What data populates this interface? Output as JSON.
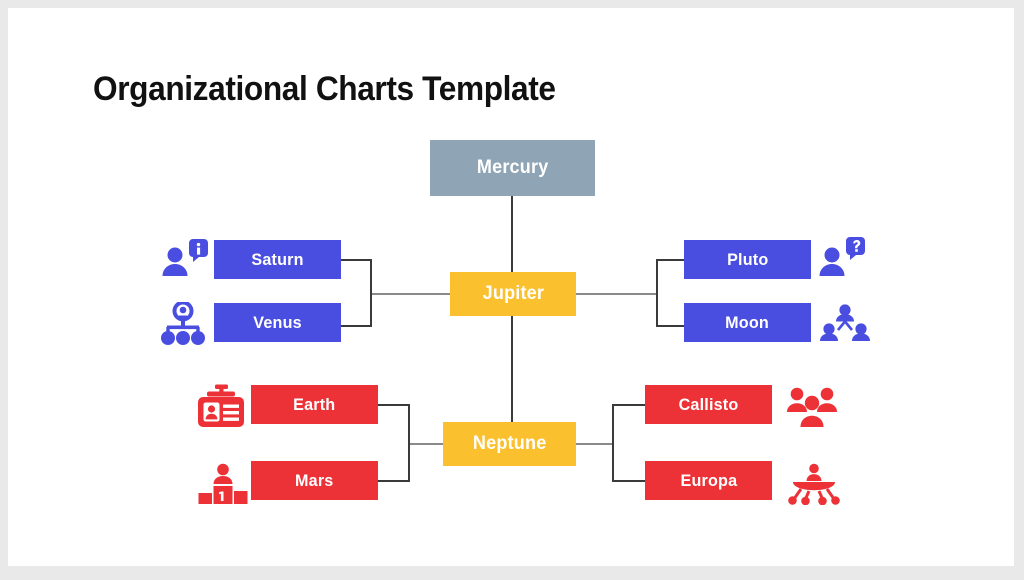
{
  "slide": {
    "title": "Organizational Charts Template",
    "background": "#ffffff",
    "frame_color": "#e9e9e9"
  },
  "colors": {
    "root": "#8fa5b6",
    "center": "#fbc02d",
    "blue": "#4a4ee0",
    "red": "#ec3237",
    "connector": "#3a3a3a",
    "connector_grey": "#8a8a8a",
    "title": "#111111",
    "node_text": "#ffffff"
  },
  "charts": [
    {
      "id": "top-chart",
      "root": {
        "label": "Mercury",
        "color": "#8fa5b6"
      },
      "center": {
        "label": "Jupiter",
        "color": "#fbc02d"
      },
      "left_children": [
        {
          "label": "Saturn",
          "color": "#4a4ee0",
          "icon": "person-info-icon"
        },
        {
          "label": "Venus",
          "color": "#4a4ee0",
          "icon": "hierarchy-icon"
        }
      ],
      "right_children": [
        {
          "label": "Pluto",
          "color": "#4a4ee0",
          "icon": "person-question-icon"
        },
        {
          "label": "Moon",
          "color": "#4a4ee0",
          "icon": "team-network-icon"
        }
      ]
    },
    {
      "id": "bottom-chart",
      "center": {
        "label": "Neptune",
        "color": "#fbc02d"
      },
      "left_children": [
        {
          "label": "Earth",
          "color": "#ec3237",
          "icon": "id-badge-icon"
        },
        {
          "label": "Mars",
          "color": "#ec3237",
          "icon": "podium-winner-icon"
        }
      ],
      "right_children": [
        {
          "label": "Callisto",
          "color": "#ec3237",
          "icon": "people-group-icon"
        },
        {
          "label": "Europa",
          "color": "#ec3237",
          "icon": "meeting-table-icon"
        }
      ]
    }
  ]
}
